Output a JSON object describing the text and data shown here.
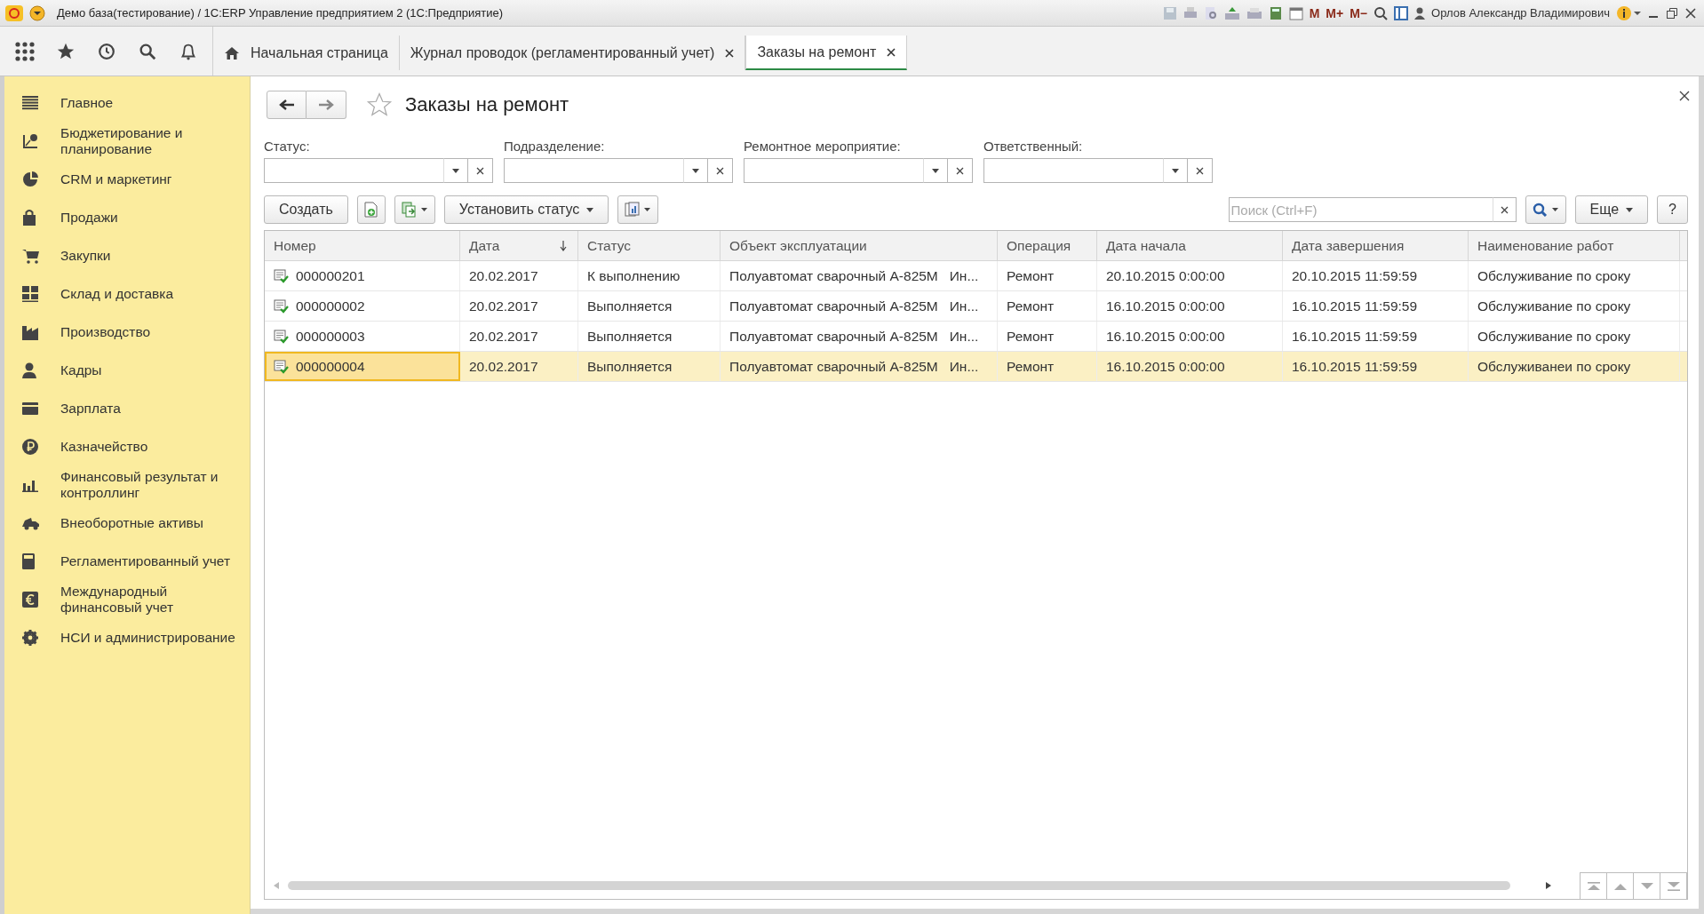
{
  "window": {
    "title": "Демо база(тестирование) / 1С:ERP Управление предприятием 2  (1С:Предприятие)",
    "memory_buttons": [
      "M",
      "M+",
      "M−"
    ],
    "user": "Орлов Александр Владимирович"
  },
  "tabs": [
    {
      "label": "Начальная страница",
      "kind": "home",
      "selected": false
    },
    {
      "label": "Журнал проводок (регламентированный учет)",
      "kind": "closable",
      "selected": false
    },
    {
      "label": "Заказы на ремонт",
      "kind": "closable",
      "selected": true
    }
  ],
  "sidebar": {
    "items": [
      {
        "label": "Главное",
        "kind": "main"
      },
      {
        "label": "Бюджетирование и планирование",
        "kind": "budget"
      },
      {
        "label": "CRM и маркетинг",
        "kind": "crm"
      },
      {
        "label": "Продажи",
        "kind": "sales"
      },
      {
        "label": "Закупки",
        "kind": "purchases"
      },
      {
        "label": "Склад и доставка",
        "kind": "warehouse"
      },
      {
        "label": "Производство",
        "kind": "production"
      },
      {
        "label": "Кадры",
        "kind": "staff"
      },
      {
        "label": "Зарплата",
        "kind": "salary"
      },
      {
        "label": "Казначейство",
        "kind": "treasury"
      },
      {
        "label": "Финансовый результат и контроллинг",
        "kind": "finance"
      },
      {
        "label": "Внеоборотные активы",
        "kind": "assets"
      },
      {
        "label": "Регламентированный учет",
        "kind": "accounting"
      },
      {
        "label": "Международный финансовый учет",
        "kind": "intl"
      },
      {
        "label": "НСИ и администрирование",
        "kind": "settings"
      }
    ]
  },
  "form": {
    "title": "Заказы на ремонт",
    "filters": [
      {
        "label": "Статус:"
      },
      {
        "label": "Подразделение:"
      },
      {
        "label": "Ремонтное мероприятие:"
      },
      {
        "label": "Ответственный:"
      }
    ],
    "toolbar": {
      "create": "Создать",
      "set_status": "Установить статус",
      "search_placeholder": "Поиск (Ctrl+F)",
      "more": "Еще",
      "help": "?"
    },
    "table": {
      "columns": [
        {
          "label": "Номер",
          "sorted": false
        },
        {
          "label": "Дата",
          "sorted": true
        },
        {
          "label": "Статус",
          "sorted": false
        },
        {
          "label": "Объект эксплуатации",
          "sorted": false
        },
        {
          "label": "Операция",
          "sorted": false
        },
        {
          "label": "Дата начала",
          "sorted": false
        },
        {
          "label": "Дата завершения",
          "sorted": false
        },
        {
          "label": "Наименование работ",
          "sorted": false
        }
      ],
      "rows": [
        {
          "number": "000000201",
          "date": "20.02.2017",
          "status": "К выполнению",
          "object": "Полуавтомат сварочный А-825М",
          "object_extra": "Ин...",
          "operation": "Ремонт",
          "start": "20.10.2015 0:00:00",
          "end": "20.10.2015 11:59:59",
          "work": "Обслуживание по сроку",
          "selected": false
        },
        {
          "number": "000000002",
          "date": "20.02.2017",
          "status": "Выполняется",
          "object": "Полуавтомат сварочный А-825М",
          "object_extra": "Ин...",
          "operation": "Ремонт",
          "start": "16.10.2015 0:00:00",
          "end": "16.10.2015 11:59:59",
          "work": "Обслуживание по сроку",
          "selected": false
        },
        {
          "number": "000000003",
          "date": "20.02.2017",
          "status": "Выполняется",
          "object": "Полуавтомат сварочный А-825М",
          "object_extra": "Ин...",
          "operation": "Ремонт",
          "start": "16.10.2015 0:00:00",
          "end": "16.10.2015 11:59:59",
          "work": "Обслуживание по сроку",
          "selected": false
        },
        {
          "number": "000000004",
          "date": "20.02.2017",
          "status": "Выполняется",
          "object": "Полуавтомат сварочный А-825М",
          "object_extra": "Ин...",
          "operation": "Ремонт",
          "start": "16.10.2015 0:00:00",
          "end": "16.10.2015 11:59:59",
          "work": "Обслуживанеи по сроку",
          "selected": true
        }
      ]
    }
  }
}
